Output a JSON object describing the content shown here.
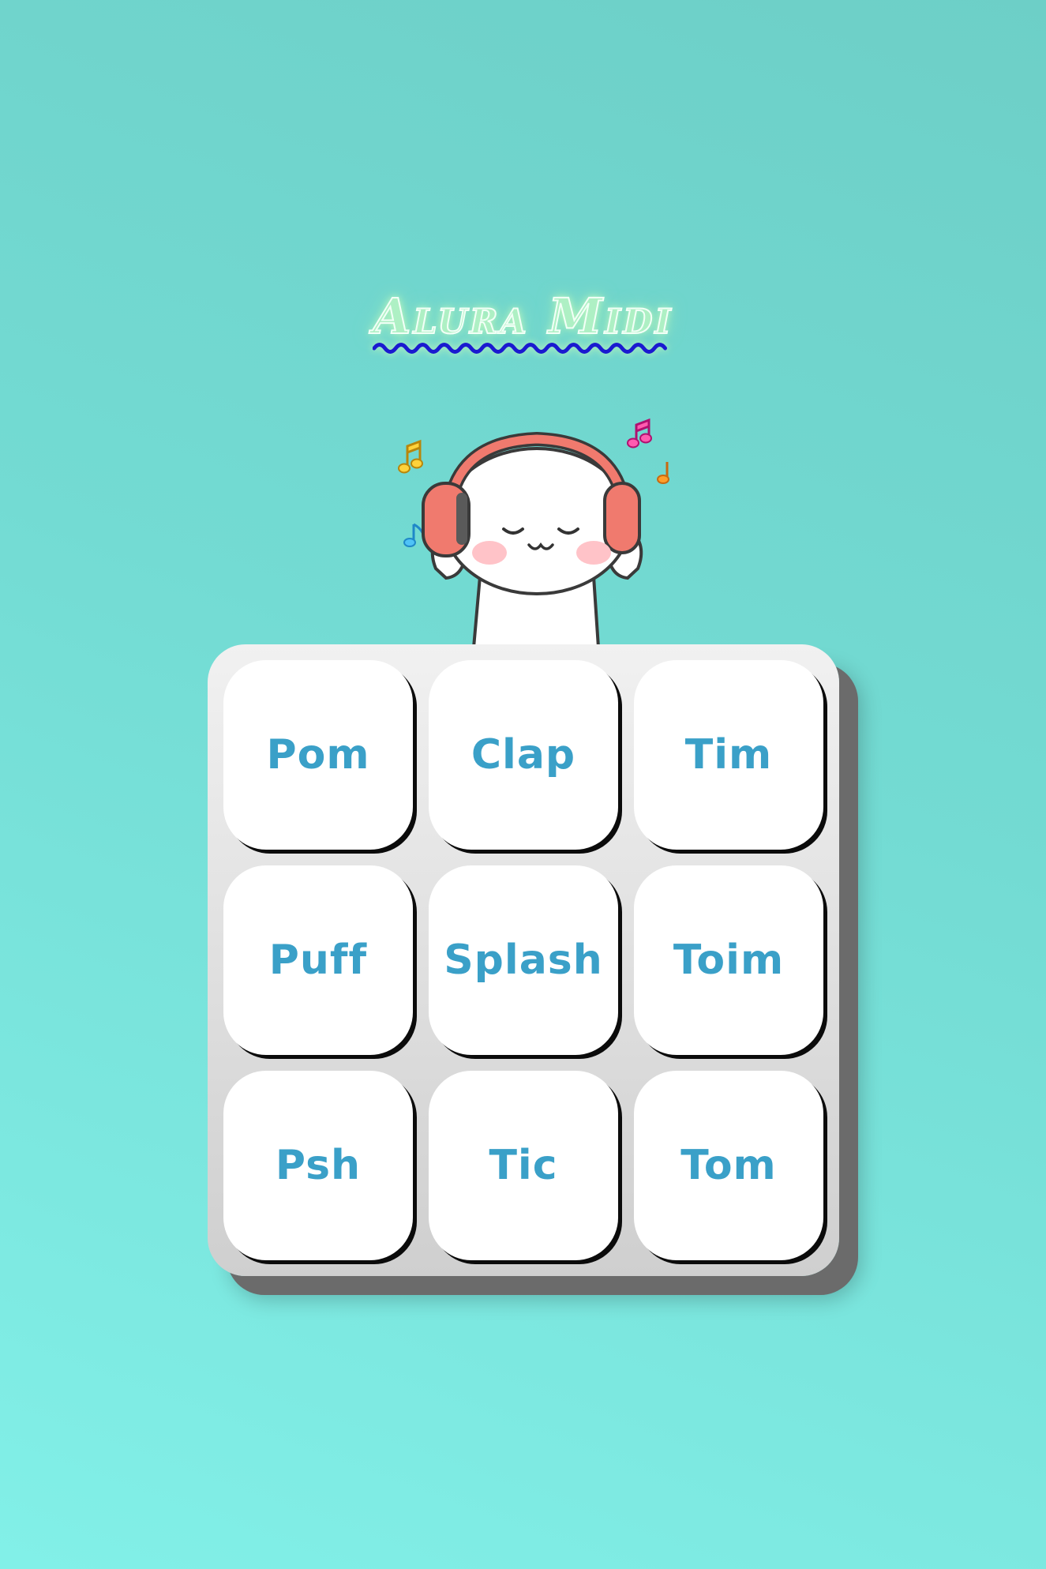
{
  "app": {
    "title": "Alura Midi"
  },
  "pads": [
    {
      "label": "Pom"
    },
    {
      "label": "Clap"
    },
    {
      "label": "Tim"
    },
    {
      "label": "Puff"
    },
    {
      "label": "Splash"
    },
    {
      "label": "Toim"
    },
    {
      "label": "Psh"
    },
    {
      "label": "Tic"
    },
    {
      "label": "Tom"
    }
  ],
  "colors": {
    "background": "#73dbd3",
    "pad_text": "#3aa0c8",
    "pad_face": "#ffffff",
    "panel": "#e2e2e2",
    "title_wave": "#1a1ad0"
  },
  "icons": {
    "mascot": "headphones-bear-icon",
    "notes": "music-note-icon"
  }
}
